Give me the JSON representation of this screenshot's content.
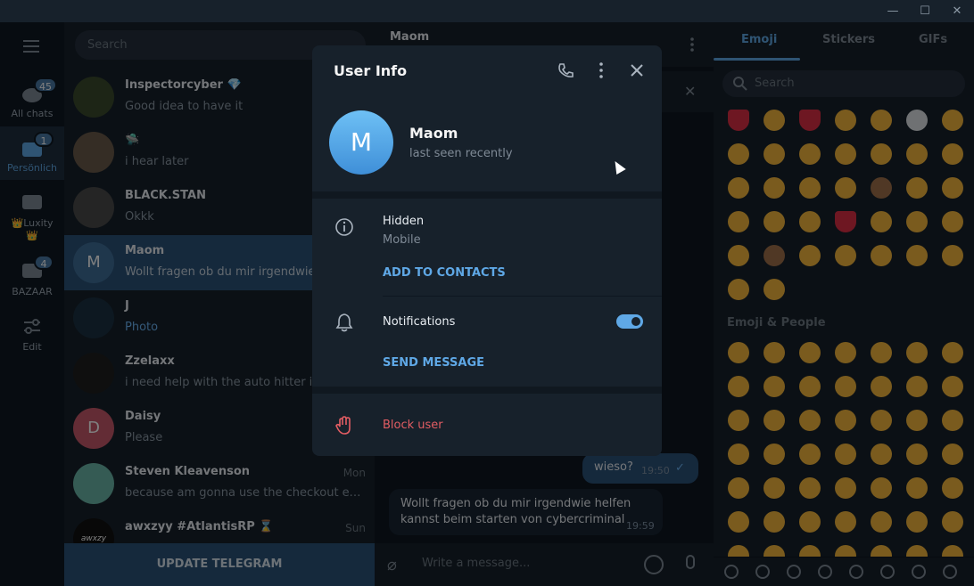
{
  "window": {
    "minimize": "—",
    "maximize": "☐",
    "close": "✕"
  },
  "folders": [
    {
      "label": "All chats",
      "badge": "45"
    },
    {
      "label": "Persönlich",
      "badge": "1"
    },
    {
      "label": "👑Luxity 👑",
      "badge": ""
    },
    {
      "label": "BAZAAR",
      "badge": "4"
    },
    {
      "label": "Edit",
      "badge": ""
    }
  ],
  "search": {
    "placeholder": "Search"
  },
  "chats": [
    {
      "name": "Inspectorcyber 💎",
      "preview": "Good idea to have it",
      "time": "",
      "initial": ""
    },
    {
      "name": "🛸",
      "preview": "i hear later",
      "time": "",
      "initial": ""
    },
    {
      "name": "BLACK.STAN",
      "preview": "Okkk",
      "time": "",
      "initial": ""
    },
    {
      "name": "Maom",
      "preview": "Wollt fragen ob du mir irgendwie helfen kannst",
      "time": "",
      "initial": "M"
    },
    {
      "name": "J",
      "preview": "Photo",
      "time": "",
      "initial": ""
    },
    {
      "name": "Zzelaxx",
      "preview": "i need help with the auto hitter if you",
      "time": "",
      "initial": ""
    },
    {
      "name": "Daisy",
      "preview": "Please",
      "time": "",
      "initial": "D"
    },
    {
      "name": "Steven Kleavenson",
      "preview": "because am gonna use the checkout express...",
      "time": "Mon",
      "initial": ""
    },
    {
      "name": "awxzyy #AtlantisRP ⌛",
      "preview": "",
      "time": "Sun",
      "initial": "awxzy"
    }
  ],
  "update_button": "UPDATE TELEGRAM",
  "conversation": {
    "title": "Maom",
    "messages": [
      {
        "text": "wieso?",
        "time": "19:50"
      },
      {
        "text": "Wollt fragen ob du mir irgendwie helfen kannst beim starten von cybercriminal",
        "time": "19:59"
      }
    ],
    "composer_placeholder": "Write a message..."
  },
  "emoji_panel": {
    "tabs": [
      "Emoji",
      "Stickers",
      "GIFs"
    ],
    "search_placeholder": "Search",
    "section_people": "Emoji & People"
  },
  "user_info": {
    "title": "User Info",
    "avatar_initial": "M",
    "name": "Maom",
    "status": "last seen recently",
    "phone": "Hidden",
    "phone_label": "Mobile",
    "add_contacts": "ADD TO CONTACTS",
    "notifications": "Notifications",
    "notifications_on": true,
    "send_message": "SEND MESSAGE",
    "block_user": "Block user"
  },
  "colors": {
    "accent": "#5fa8e6",
    "danger": "#e35d63",
    "panel": "#17212b",
    "background": "#0e1621"
  }
}
